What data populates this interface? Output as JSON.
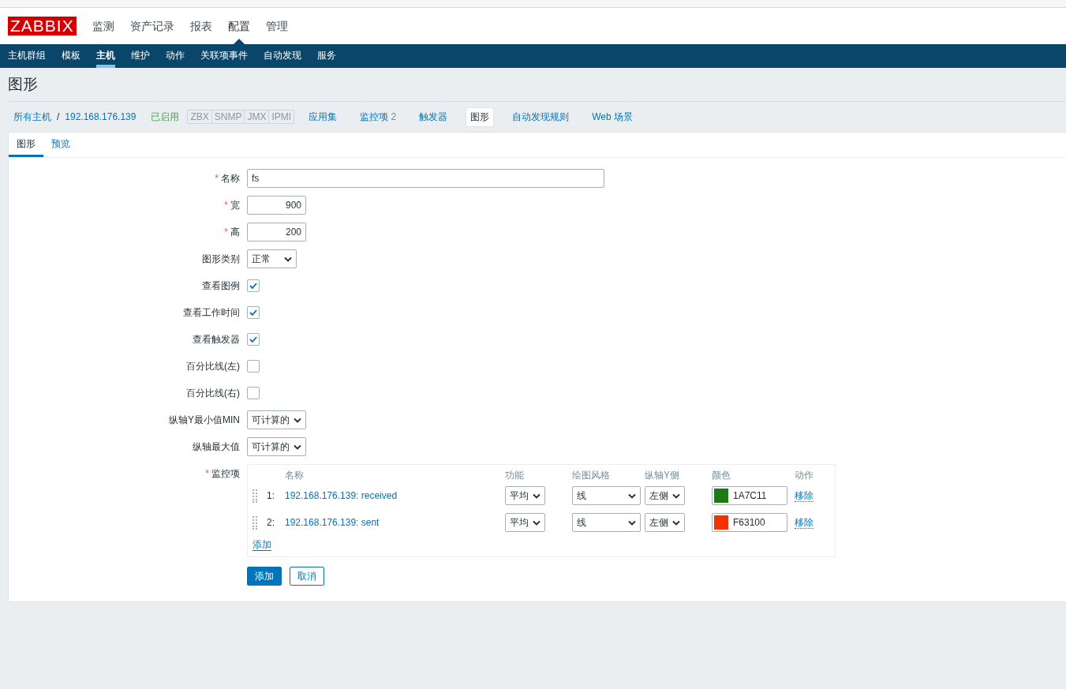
{
  "logo": "ZABBIX",
  "top_menu": [
    {
      "label": "监测",
      "selected": false
    },
    {
      "label": "资产记录",
      "selected": false
    },
    {
      "label": "报表",
      "selected": false
    },
    {
      "label": "配置",
      "selected": true
    },
    {
      "label": "管理",
      "selected": false
    }
  ],
  "sub_menu": [
    {
      "label": "主机群组",
      "selected": false
    },
    {
      "label": "模板",
      "selected": false
    },
    {
      "label": "主机",
      "selected": true
    },
    {
      "label": "维护",
      "selected": false
    },
    {
      "label": "动作",
      "selected": false
    },
    {
      "label": "关联项事件",
      "selected": false
    },
    {
      "label": "自动发现",
      "selected": false
    },
    {
      "label": "服务",
      "selected": false
    }
  ],
  "page_title": "图形",
  "host_bar": {
    "all_hosts": "所有主机",
    "separator": "/",
    "host": "192.168.176.139",
    "status": "已启用",
    "interfaces": [
      "ZBX",
      "SNMP",
      "JMX",
      "IPMI"
    ],
    "links": [
      {
        "label": "应用集",
        "selected": false
      },
      {
        "label": "监控项",
        "count": "2",
        "selected": false
      },
      {
        "label": "触发器",
        "selected": false
      },
      {
        "label": "图形",
        "selected": true
      },
      {
        "label": "自动发现规则",
        "selected": false
      },
      {
        "label": "Web 场景",
        "selected": false
      }
    ]
  },
  "form_tabs": [
    {
      "label": "图形",
      "selected": true
    },
    {
      "label": "预览",
      "selected": false
    }
  ],
  "fields": [
    {
      "kind": "text",
      "required_mark": "*",
      "label": "名称",
      "value": "fs"
    },
    {
      "kind": "number",
      "required_mark": "*",
      "label": "宽",
      "value": "900"
    },
    {
      "kind": "number",
      "required_mark": "*",
      "label": "高",
      "value": "200"
    },
    {
      "kind": "select",
      "label": "图形类别",
      "value": "正常"
    },
    {
      "kind": "checkbox",
      "label": "查看图例",
      "checked": true
    },
    {
      "kind": "checkbox",
      "label": "查看工作时间",
      "checked": true
    },
    {
      "kind": "checkbox",
      "label": "查看触发器",
      "checked": true
    },
    {
      "kind": "checkbox",
      "label": "百分比线(左)",
      "checked": false
    },
    {
      "kind": "checkbox",
      "label": "百分比线(右)",
      "checked": false
    },
    {
      "kind": "select",
      "label": "纵轴Y最小值MIN",
      "value": "可计算的"
    },
    {
      "kind": "select",
      "label": "纵轴最大值",
      "value": "可计算的"
    }
  ],
  "items": {
    "required_mark": "*",
    "label": "监控项",
    "columns": [
      "名称",
      "功能",
      "绘图风格",
      "纵轴Y侧",
      "颜色",
      "动作"
    ],
    "rows": [
      {
        "index": "1:",
        "name": "192.168.176.139: received",
        "function": "平均",
        "draw_style": "线",
        "y_axis": "左侧",
        "color": "#1a7c11",
        "color_text": "1A7C11",
        "action": "移除"
      },
      {
        "index": "2:",
        "name": "192.168.176.139: sent",
        "function": "平均",
        "draw_style": "线",
        "y_axis": "左侧",
        "color": "#f63100",
        "color_text": "F63100",
        "action": "移除"
      }
    ],
    "add_link": "添加"
  },
  "buttons": [
    {
      "kind": "primary",
      "label": "添加"
    },
    {
      "kind": "secondary",
      "label": "取消"
    }
  ]
}
